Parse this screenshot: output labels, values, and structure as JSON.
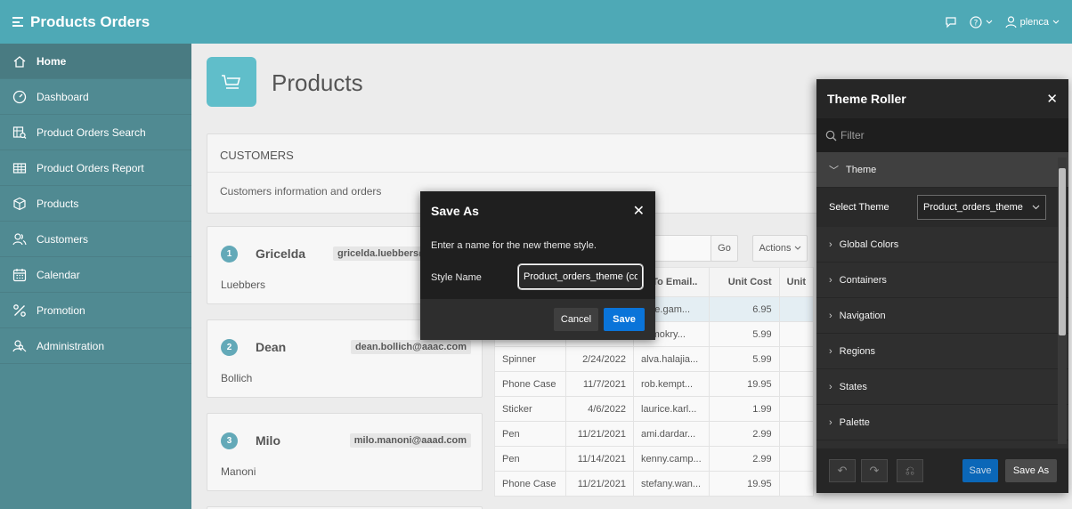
{
  "app": {
    "title": "Products Orders",
    "user": "plenca"
  },
  "sidebar": {
    "items": [
      {
        "label": "Home",
        "icon": "home-icon"
      },
      {
        "label": "Dashboard",
        "icon": "dashboard-icon"
      },
      {
        "label": "Product Orders Search",
        "icon": "search-form-icon"
      },
      {
        "label": "Product Orders Report",
        "icon": "table-icon"
      },
      {
        "label": "Products",
        "icon": "box-icon"
      },
      {
        "label": "Customers",
        "icon": "users-icon"
      },
      {
        "label": "Calendar",
        "icon": "calendar-icon"
      },
      {
        "label": "Promotion",
        "icon": "percent-icon"
      },
      {
        "label": "Administration",
        "icon": "user-wrench-icon"
      }
    ]
  },
  "page": {
    "title": "Products"
  },
  "customers_region": {
    "title": "CUSTOMERS",
    "description": "Customers information and orders"
  },
  "cards": [
    {
      "num": "1",
      "first": "Gricelda",
      "email": "gricelda.luebbers@",
      "last": "Luebbers"
    },
    {
      "num": "2",
      "first": "Dean",
      "email": "dean.bollich@aaac.com",
      "last": "Bollich"
    },
    {
      "num": "3",
      "first": "Milo",
      "email": "milo.manoni@aaad.com",
      "last": "Manoni"
    }
  ],
  "report": {
    "go_label": "Go",
    "actions_label": "Actions",
    "headers": {
      "email": "le To Email..",
      "cost": "Unit Cost",
      "unit": "Unit"
    },
    "rows": [
      {
        "product": "",
        "date": "",
        "email": "mee.gam...",
        "cost": "6.95"
      },
      {
        "product": "",
        "date": "",
        "email": "ul.mokry...",
        "cost": "5.99"
      },
      {
        "product": "Spinner",
        "date": "2/24/2022",
        "email": "alva.halajia...",
        "cost": "5.99"
      },
      {
        "product": "Phone Case",
        "date": "11/7/2021",
        "email": "rob.kempt...",
        "cost": "19.95"
      },
      {
        "product": "Sticker",
        "date": "4/6/2022",
        "email": "laurice.karl...",
        "cost": "1.99"
      },
      {
        "product": "Pen",
        "date": "11/21/2021",
        "email": "ami.dardar...",
        "cost": "2.99"
      },
      {
        "product": "Pen",
        "date": "11/14/2021",
        "email": "kenny.camp...",
        "cost": "2.99"
      },
      {
        "product": "Phone Case",
        "date": "11/21/2021",
        "email": "stefany.wan...",
        "cost": "19.95"
      }
    ]
  },
  "save_dialog": {
    "title": "Save As",
    "message": "Enter a name for the new theme style.",
    "field_label": "Style Name",
    "field_value": "Product_orders_theme (copy)",
    "cancel_label": "Cancel",
    "save_label": "Save"
  },
  "theme_roller": {
    "title": "Theme Roller",
    "filter_placeholder": "Filter",
    "theme_section": "Theme",
    "select_theme_label": "Select Theme",
    "selected_theme": "Product_orders_theme",
    "sections": [
      "Global Colors",
      "Containers",
      "Navigation",
      "Regions",
      "States",
      "Palette"
    ],
    "save_label": "Save",
    "save_as_label": "Save As"
  },
  "colors": {
    "header": "#138c9e",
    "sidebar": "#16636e",
    "accent": "#2ba8b9",
    "primary_button": "#0a74d9"
  }
}
